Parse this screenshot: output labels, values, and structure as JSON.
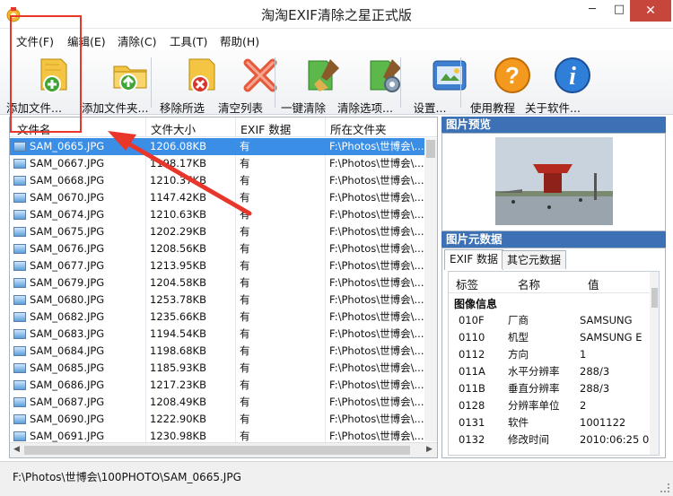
{
  "window": {
    "title": "淘淘EXIF清除之星正式版",
    "minimize": "─",
    "maximize": "□",
    "close": "✕"
  },
  "menu": [
    "文件(F)",
    "编辑(E)",
    "清除(C)",
    "工具(T)",
    "帮助(H)"
  ],
  "toolbar": [
    {
      "label": "添加文件...",
      "icon": "add-file-icon"
    },
    {
      "label": "添加文件夹...",
      "icon": "add-folder-icon"
    },
    {
      "label": "移除所选",
      "icon": "remove-selected-icon"
    },
    {
      "label": "清空列表",
      "icon": "clear-list-icon"
    },
    {
      "label": "一键清除",
      "icon": "one-click-clean-icon"
    },
    {
      "label": "清除选项...",
      "icon": "clean-options-icon"
    },
    {
      "label": "设置...",
      "icon": "settings-icon"
    },
    {
      "label": "使用教程",
      "icon": "help-tutorial-icon"
    },
    {
      "label": "关于软件...",
      "icon": "about-icon"
    }
  ],
  "file_list": {
    "columns": [
      "文件名",
      "文件大小",
      "EXIF 数据",
      "所在文件夹"
    ],
    "rows": [
      {
        "name": "SAM_0665.JPG",
        "size": "1206.08KB",
        "exif": "有",
        "folder": "F:\\Photos\\世博会\\..."
      },
      {
        "name": "SAM_0667.JPG",
        "size": "1198.17KB",
        "exif": "有",
        "folder": "F:\\Photos\\世博会\\..."
      },
      {
        "name": "SAM_0668.JPG",
        "size": "1210.37KB",
        "exif": "有",
        "folder": "F:\\Photos\\世博会\\..."
      },
      {
        "name": "SAM_0670.JPG",
        "size": "1147.42KB",
        "exif": "有",
        "folder": "F:\\Photos\\世博会\\..."
      },
      {
        "name": "SAM_0674.JPG",
        "size": "1210.63KB",
        "exif": "有",
        "folder": "F:\\Photos\\世博会\\..."
      },
      {
        "name": "SAM_0675.JPG",
        "size": "1202.29KB",
        "exif": "有",
        "folder": "F:\\Photos\\世博会\\..."
      },
      {
        "name": "SAM_0676.JPG",
        "size": "1208.56KB",
        "exif": "有",
        "folder": "F:\\Photos\\世博会\\..."
      },
      {
        "name": "SAM_0677.JPG",
        "size": "1213.95KB",
        "exif": "有",
        "folder": "F:\\Photos\\世博会\\..."
      },
      {
        "name": "SAM_0679.JPG",
        "size": "1204.58KB",
        "exif": "有",
        "folder": "F:\\Photos\\世博会\\..."
      },
      {
        "name": "SAM_0680.JPG",
        "size": "1253.78KB",
        "exif": "有",
        "folder": "F:\\Photos\\世博会\\..."
      },
      {
        "name": "SAM_0682.JPG",
        "size": "1235.66KB",
        "exif": "有",
        "folder": "F:\\Photos\\世博会\\..."
      },
      {
        "name": "SAM_0683.JPG",
        "size": "1194.54KB",
        "exif": "有",
        "folder": "F:\\Photos\\世博会\\..."
      },
      {
        "name": "SAM_0684.JPG",
        "size": "1198.68KB",
        "exif": "有",
        "folder": "F:\\Photos\\世博会\\..."
      },
      {
        "name": "SAM_0685.JPG",
        "size": "1185.93KB",
        "exif": "有",
        "folder": "F:\\Photos\\世博会\\..."
      },
      {
        "name": "SAM_0686.JPG",
        "size": "1217.23KB",
        "exif": "有",
        "folder": "F:\\Photos\\世博会\\..."
      },
      {
        "name": "SAM_0687.JPG",
        "size": "1208.49KB",
        "exif": "有",
        "folder": "F:\\Photos\\世博会\\..."
      },
      {
        "name": "SAM_0690.JPG",
        "size": "1222.90KB",
        "exif": "有",
        "folder": "F:\\Photos\\世博会\\..."
      },
      {
        "name": "SAM_0691.JPG",
        "size": "1230.98KB",
        "exif": "有",
        "folder": "F:\\Photos\\世博会\\..."
      }
    ],
    "selected_index": 0
  },
  "preview": {
    "title": "图片预览"
  },
  "metadata": {
    "title": "图片元数据",
    "tabs": [
      "EXIF 数据",
      "其它元数据"
    ],
    "active_tab": 0,
    "columns": [
      "标签",
      "名称",
      "值"
    ],
    "group": "图像信息",
    "rows": [
      {
        "tag": "010F",
        "name": "厂商",
        "value": "SAMSUNG"
      },
      {
        "tag": "0110",
        "name": "机型",
        "value": "SAMSUNG E"
      },
      {
        "tag": "0112",
        "name": "方向",
        "value": "1"
      },
      {
        "tag": "011A",
        "name": "水平分辨率",
        "value": "288/3"
      },
      {
        "tag": "011B",
        "name": "垂直分辨率",
        "value": "288/3"
      },
      {
        "tag": "0128",
        "name": "分辨率单位",
        "value": "2"
      },
      {
        "tag": "0131",
        "name": "软件",
        "value": "1001122"
      },
      {
        "tag": "0132",
        "name": "修改时间",
        "value": "2010:06:25 0..."
      }
    ]
  },
  "status": {
    "path": "F:\\Photos\\世博会\\100PHOTO\\SAM_0665.JPG"
  },
  "colors": {
    "panel_header": "#3c72b5",
    "selection": "#3a8ee6",
    "annotation": "#e8362b",
    "close_button": "#c7463c"
  }
}
